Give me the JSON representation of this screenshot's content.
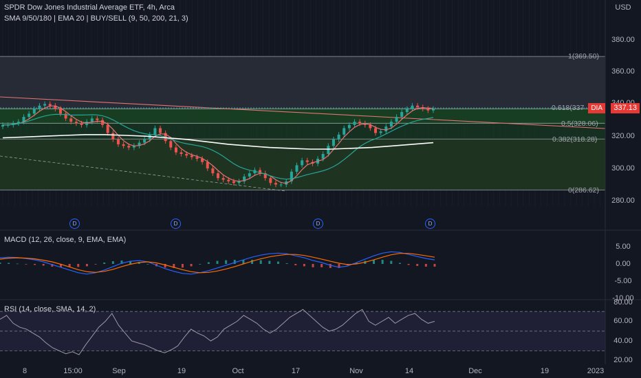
{
  "header": {
    "title": "SPDR Dow Jones Industrial Average ETF, 4h, Arca",
    "indicators": "SMA 9/50/180 | EMA 20 | BUY/SELL (9, 50, 200, 21, 3)",
    "currency": "USD"
  },
  "price_tag": {
    "symbol": "DIA",
    "value": "337.13"
  },
  "fib_labels": [
    "1(369.50)",
    "0.618(337",
    "0.5(328.06)",
    "0.382(318.28)",
    "0(286.62)"
  ],
  "dividend_marker": "D",
  "macd_title": "MACD (12, 26, close, 9, EMA, EMA)",
  "rsi_title": "RSI (14, close, SMA, 14, 2)",
  "price_axis": [
    "380.00",
    "360.00",
    "340.00",
    "320.00",
    "300.00",
    "280.00"
  ],
  "macd_axis": [
    "5.00",
    "0.00",
    "-5.00",
    "-10.00"
  ],
  "rsi_axis": [
    "80.00",
    "60.00",
    "40.00",
    "20.00"
  ],
  "time_axis": [
    "8",
    "15:00",
    "Sep",
    "19",
    "Oct",
    "17",
    "Nov",
    "14",
    "Dec",
    "19",
    "2023"
  ],
  "colors": {
    "up": "#26a69a",
    "down": "#ef5350",
    "sma9": "#e57373",
    "sma50": "#26a69a",
    "sma180": "#ffffff",
    "fib_upper": "#2a2e39",
    "fib_green": "#1b5e20",
    "fib_olive": "#33691e",
    "rsi_band": "#7e57c2"
  },
  "chart_data": [
    {
      "type": "candlestick",
      "title": "SPDR Dow Jones Industrial Average ETF, 4h, Arca",
      "ylabel": "USD",
      "ylim": [
        276,
        392
      ],
      "close_series": [
        327,
        327,
        328,
        329,
        332,
        334,
        337,
        339,
        340,
        339,
        337,
        334,
        331,
        329,
        328,
        327,
        329,
        331,
        330,
        327,
        322,
        318,
        315,
        314,
        313,
        314,
        316,
        318,
        321,
        325,
        322,
        317,
        313,
        310,
        309,
        308,
        307,
        306,
        304,
        300,
        297,
        294,
        293,
        292,
        291,
        292,
        295,
        297,
        299,
        297,
        294,
        291,
        290,
        290,
        292,
        298,
        302,
        305,
        304,
        303,
        306,
        309,
        314,
        318,
        321,
        325,
        327,
        329,
        328,
        327,
        325,
        322,
        323,
        326,
        329,
        332,
        335,
        337,
        339,
        338,
        337,
        336,
        337
      ],
      "sma_180": [
        319,
        319.5,
        320,
        320.5,
        321,
        321,
        320.5,
        320,
        319,
        318,
        316.5,
        315,
        314,
        313,
        312.5,
        312,
        312,
        312.5,
        313,
        314,
        315,
        316
      ],
      "fib_levels": [
        {
          "level": 1,
          "price": 369.5
        },
        {
          "level": 0.618,
          "price": 337
        },
        {
          "level": 0.5,
          "price": 328.06
        },
        {
          "level": 0.382,
          "price": 318.28
        },
        {
          "level": 0,
          "price": 286.62
        }
      ],
      "last_price": 337.13
    },
    {
      "type": "line",
      "title": "MACD (12, 26, close, 9, EMA, EMA)",
      "ylim": [
        -10,
        7
      ],
      "macd": [
        1.8,
        2.0,
        1.9,
        1.6,
        1.2,
        0.6,
        -0.2,
        -1.0,
        -1.8,
        -2.6,
        -3.0,
        -2.6,
        -1.8,
        -0.8,
        0.2,
        0.8,
        1.0,
        0.6,
        -0.4,
        -1.4,
        -2.2,
        -2.8,
        -3.0,
        -2.6,
        -2.0,
        -1.2,
        -0.4,
        0.4,
        1.2,
        2.0,
        2.6,
        3.0,
        3.2,
        3.0,
        2.4,
        1.8,
        1.0,
        0.4,
        -0.4,
        -1.0,
        -0.6,
        0.4,
        1.4,
        2.4,
        3.2,
        3.6,
        3.4,
        2.8,
        2.2,
        1.6,
        1.2
      ],
      "signal": [
        1.4,
        1.7,
        1.8,
        1.7,
        1.5,
        1.1,
        0.6,
        -0.1,
        -0.9,
        -1.7,
        -2.3,
        -2.5,
        -2.2,
        -1.6,
        -0.8,
        -0.1,
        0.4,
        0.6,
        0.3,
        -0.3,
        -1.0,
        -1.7,
        -2.3,
        -2.6,
        -2.5,
        -2.1,
        -1.5,
        -0.8,
        0.0,
        0.8,
        1.5,
        2.1,
        2.5,
        2.8,
        2.8,
        2.5,
        2.0,
        1.4,
        0.8,
        0.2,
        -0.2,
        0.0,
        0.5,
        1.2,
        2.0,
        2.7,
        3.1,
        3.1,
        2.8,
        2.4,
        2.0
      ]
    },
    {
      "type": "line",
      "title": "RSI (14, close, SMA, 14, 2)",
      "ylim": [
        20,
        82
      ],
      "rsi": [
        62,
        66,
        58,
        54,
        52,
        48,
        44,
        38,
        33,
        30,
        27,
        29,
        26,
        36,
        45,
        54,
        60,
        68,
        56,
        48,
        40,
        38,
        36,
        33,
        30,
        28,
        31,
        35,
        44,
        52,
        48,
        45,
        40,
        44,
        52,
        56,
        60,
        66,
        62,
        58,
        52,
        48,
        52,
        58,
        64,
        68,
        72,
        66,
        60,
        54,
        50,
        52,
        56,
        62,
        68,
        72,
        60,
        56,
        60,
        64,
        58,
        62,
        66,
        68,
        62,
        58,
        60
      ]
    }
  ]
}
